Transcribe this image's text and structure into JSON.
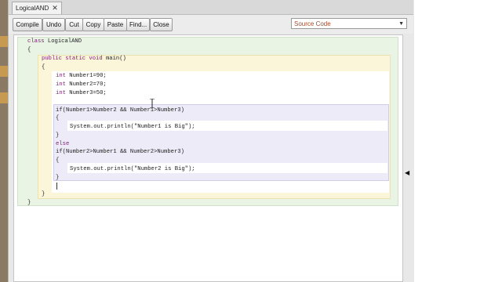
{
  "window": {
    "tab_label": "LogicalAND",
    "tab_close": "✕"
  },
  "toolbar": {
    "compile": "Compile",
    "undo": "Undo",
    "cut": "Cut",
    "copy": "Copy",
    "paste": "Paste",
    "find": "Find...",
    "close": "Close",
    "view_select": "Source Code"
  },
  "code": {
    "lines": [
      {
        "text": "class LogicalAND"
      },
      {
        "text": "{"
      },
      {
        "text": "public static void main()"
      },
      {
        "text": "{"
      },
      {
        "text": "int Number1=90;"
      },
      {
        "text": "int Number2=70;"
      },
      {
        "text": "int Number3=50;"
      },
      {
        "text": "if(Number1>Number2 && Number1>Number3)"
      },
      {
        "text": "{"
      },
      {
        "text": "System.out.println(\"Number1 is Big\");"
      },
      {
        "text": "}"
      },
      {
        "text": "else"
      },
      {
        "text": "if(Number2>Number1 && Number2>Number3)"
      },
      {
        "text": "{"
      },
      {
        "text": "System.out.println(\"Number2 is Big\");"
      },
      {
        "text": "}"
      },
      {
        "text": "}"
      },
      {
        "text": "}"
      }
    ]
  },
  "colors": {
    "class_scope": "#e9f4e5",
    "method_scope": "#fbf6d9",
    "if_scope": "#ecebf7",
    "keyword": "#7a1f6e"
  }
}
